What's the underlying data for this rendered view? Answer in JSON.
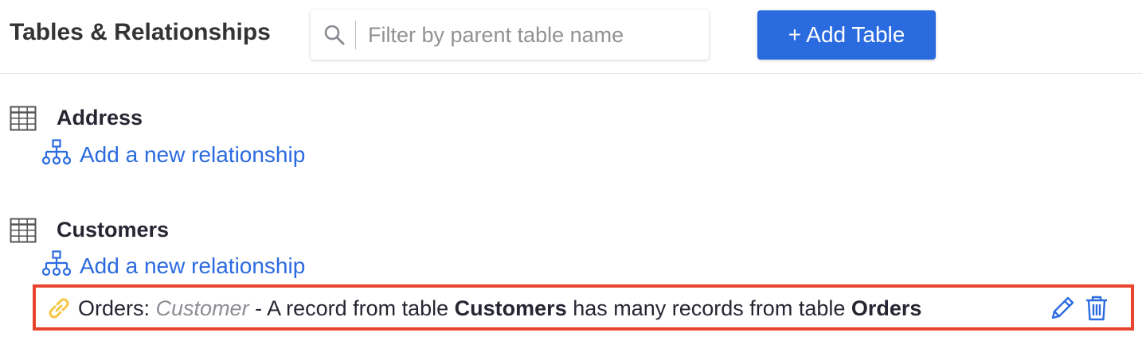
{
  "header": {
    "title": "Tables & Relationships",
    "search": {
      "placeholder": "Filter by parent table name",
      "value": ""
    },
    "add_table_label": "+ Add Table"
  },
  "colors": {
    "accent": "#2b6be0",
    "highlight": "#e8432c",
    "link_icon": "#f5c644"
  },
  "tables": [
    {
      "name": "Address",
      "add_relationship_label": "Add a new relationship",
      "relationships": []
    },
    {
      "name": "Customers",
      "add_relationship_label": "Add a new relationship",
      "relationships": [
        {
          "icon": "link-icon",
          "name_prefix": "Orders: ",
          "column": "Customer",
          "text_1": " - A record from table ",
          "parent_table": "Customers",
          "text_2": " has many records from table ",
          "child_table": "Orders",
          "actions": [
            "edit-icon",
            "delete-icon"
          ]
        }
      ]
    }
  ]
}
